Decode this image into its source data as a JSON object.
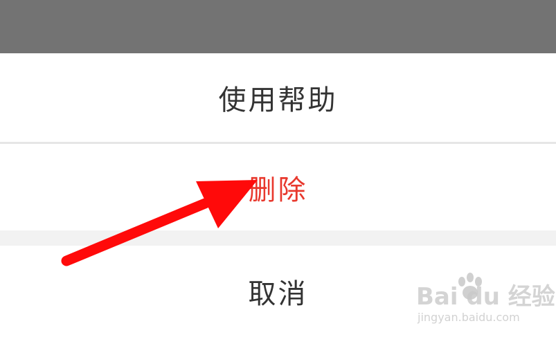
{
  "action_sheet": {
    "help_label": "使用帮助",
    "delete_label": "删除",
    "cancel_label": "取消"
  },
  "colors": {
    "overlay": "#737373",
    "delete_text": "#e8382d",
    "normal_text": "#333333",
    "arrow": "#ff0000"
  },
  "icons": {
    "annotation": "red-arrow-icon",
    "watermark": "baidu-jingyan-watermark"
  },
  "watermark": {
    "logo_text": "Bai du 经验",
    "sub_text": "jingyan.baidu.com"
  }
}
